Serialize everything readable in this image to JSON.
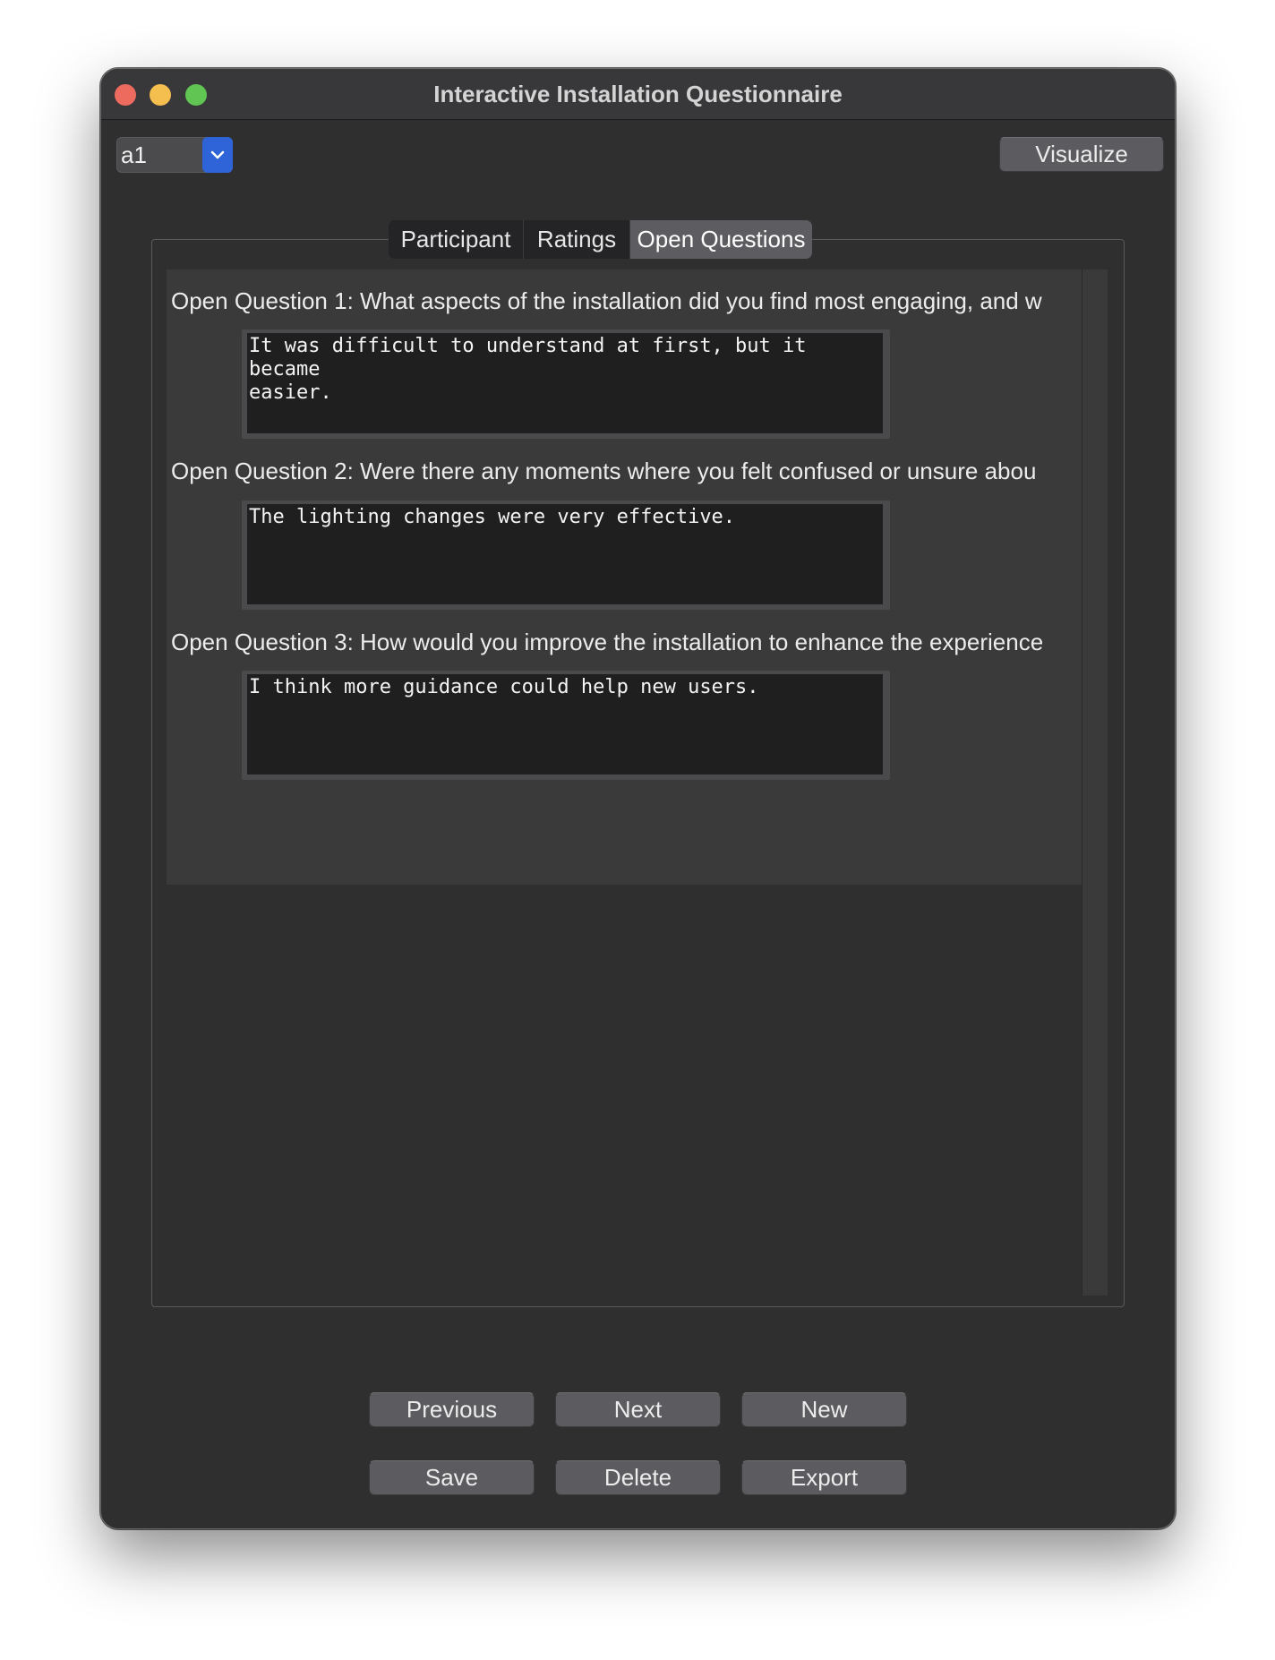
{
  "window": {
    "title": "Interactive Installation Questionnaire"
  },
  "toolbar": {
    "participant_select_value": "a1",
    "visualize_label": "Visualize"
  },
  "tabs": [
    {
      "label": "Participant",
      "active": false
    },
    {
      "label": "Ratings",
      "active": false
    },
    {
      "label": "Open Questions",
      "active": true
    }
  ],
  "open_questions": [
    {
      "question": "Open Question 1: What aspects of the installation did you find most engaging, and w",
      "answer": "It was difficult to understand at first, but it became\neasier."
    },
    {
      "question": "Open Question 2: Were there any moments where you felt confused or unsure abou",
      "answer": "The lighting changes were very effective."
    },
    {
      "question": "Open Question 3: How would you improve the installation to enhance the experience",
      "answer": "I think more guidance could help new users."
    }
  ],
  "buttons": {
    "previous": "Previous",
    "next": "Next",
    "new": "New",
    "save": "Save",
    "delete": "Delete",
    "export": "Export"
  },
  "colors": {
    "window_bg": "#2f2f30",
    "accent": "#2f64d8",
    "close": "#ed6a5e",
    "minimize": "#f5bf4f",
    "maximize": "#61c554"
  }
}
